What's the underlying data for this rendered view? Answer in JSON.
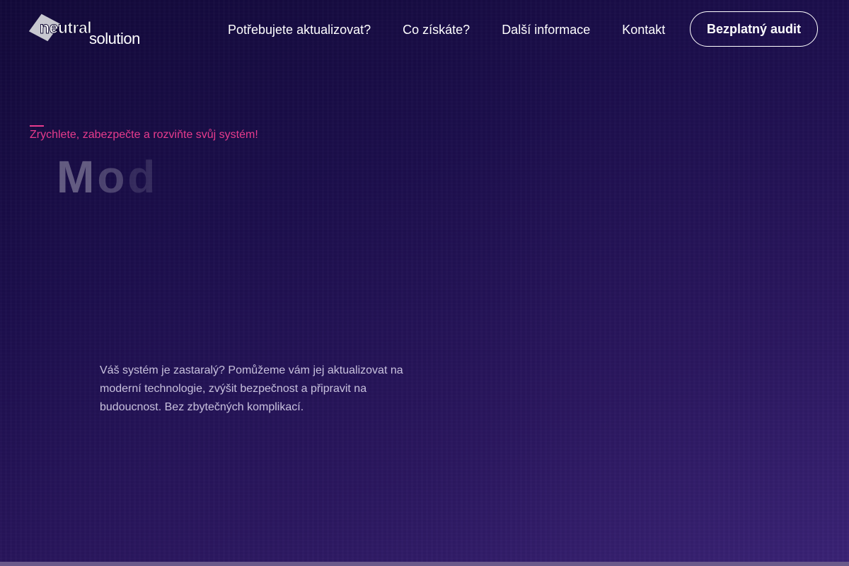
{
  "brand": {
    "logo_word1": "neutral",
    "logo_word2": "solution"
  },
  "nav": {
    "items": [
      {
        "label": "Potřebujete aktualizovat?"
      },
      {
        "label": "Co získáte?"
      },
      {
        "label": "Další informace"
      },
      {
        "label": "Kontakt"
      }
    ],
    "cta_label": "Bezplatný audit"
  },
  "hero": {
    "eyebrow": "Zrychlete, zabezpečte a rozviňte svůj systém!",
    "title_visible_chars": [
      "M",
      "o",
      "d"
    ],
    "intro": "Váš systém je zastaralý? Pomůžeme vám jej aktualizovat na moderní technologie, zvýšit bezpečnost a připravit na budoucnost. Bez zbytečných komplikací."
  },
  "colors": {
    "accent": "#e83b8d",
    "background_top": "#12093a",
    "background_bottom": "#3a2275"
  },
  "icons": {
    "logo_mark": "diamond-logo-icon"
  }
}
